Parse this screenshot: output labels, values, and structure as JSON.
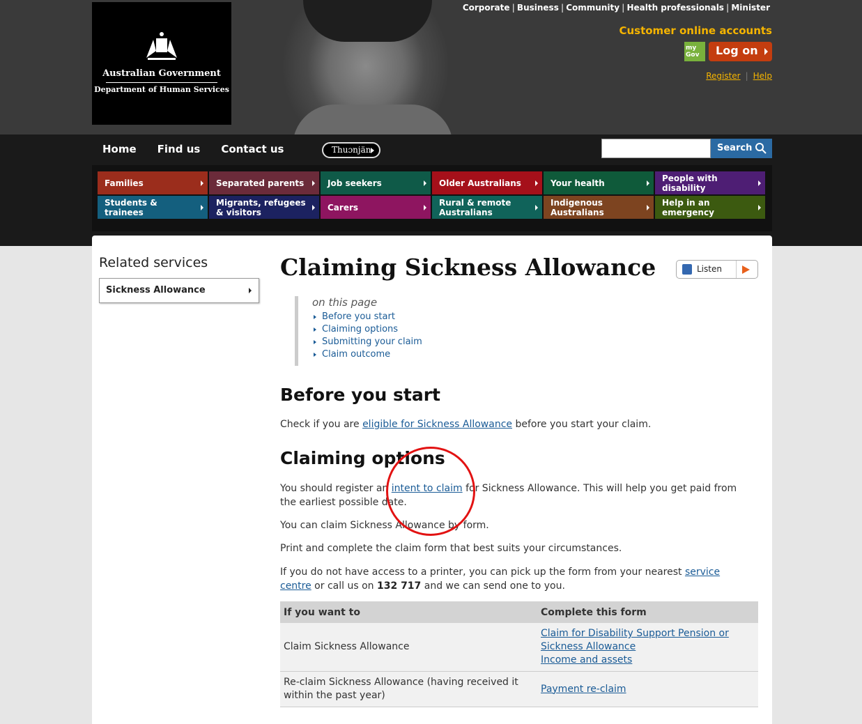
{
  "header": {
    "logo_line1": "Australian Government",
    "logo_line2": "Department of Human Services",
    "top_links": [
      "Corporate",
      "Business",
      "Community",
      "Health professionals",
      "Minister"
    ],
    "customer_accounts": "Customer online accounts",
    "mygov_line1": "my",
    "mygov_line2": "Gov",
    "logon_label": "Log on",
    "register_label": "Register",
    "help_label": "Help"
  },
  "nav": {
    "home": "Home",
    "find_us": "Find us",
    "contact_us": "Contact us",
    "thuonjan": "Thuɔnjän",
    "search_label": "Search",
    "search_value": ""
  },
  "categories": [
    {
      "label": "Families",
      "color": "#9b2d1c"
    },
    {
      "label": "Separated parents",
      "color": "#6b2b3a"
    },
    {
      "label": "Job seekers",
      "color": "#0f5a48"
    },
    {
      "label": "Older Australians",
      "color": "#a5101a"
    },
    {
      "label": "Your health",
      "color": "#0f5a3a"
    },
    {
      "label": "People with disability",
      "color": "#4e1e74"
    },
    {
      "label": "Students & trainees",
      "color": "#145f7e"
    },
    {
      "label": "Migrants, refugees & visitors",
      "color": "#1c2260"
    },
    {
      "label": "Carers",
      "color": "#8e1560"
    },
    {
      "label": "Rural & remote Australians",
      "color": "#10635a"
    },
    {
      "label": "Indigenous Australians",
      "color": "#7d4420"
    },
    {
      "label": "Help in an emergency",
      "color": "#3c5a10"
    }
  ],
  "sidebar": {
    "heading": "Related services",
    "item": "Sickness Allowance"
  },
  "main": {
    "title": "Claiming Sickness Allowance",
    "listen": "Listen",
    "on_this_page": "on this page",
    "toc": [
      "Before you start",
      "Claiming options",
      "Submitting your claim",
      "Claim outcome"
    ],
    "before_heading": "Before you start",
    "before_p_pre": "Check if you are ",
    "before_p_link": "eligible for Sickness Allowance",
    "before_p_post": " before you start your claim.",
    "options_heading": "Claiming options",
    "options_p1_pre": "You should register an ",
    "options_p1_link": "intent to claim",
    "options_p1_post": " for Sickness Allowance. This will help you get paid from the earliest possible date.",
    "options_p2": "You can claim Sickness Allowance by form.",
    "options_p3": "Print and complete the claim form that best suits your circumstances.",
    "options_p4_pre": "If you do not have access to a printer, you can pick up the form from your nearest ",
    "options_p4_link": "service centre",
    "options_p4_mid": " or call us on ",
    "options_p4_phone": "132 717",
    "options_p4_post": " and we can send one to you."
  },
  "table": {
    "col1": "If you want to",
    "col2": "Complete this form",
    "row1_col1": "Claim Sickness Allowance",
    "row1_link1": "Claim for Disability Support Pension or Sickness Allowance",
    "row1_link2": "Income and assets",
    "row2_col1": "Re-claim Sickness Allowance (having received it within the past year)",
    "row2_link": "Payment re-claim"
  }
}
